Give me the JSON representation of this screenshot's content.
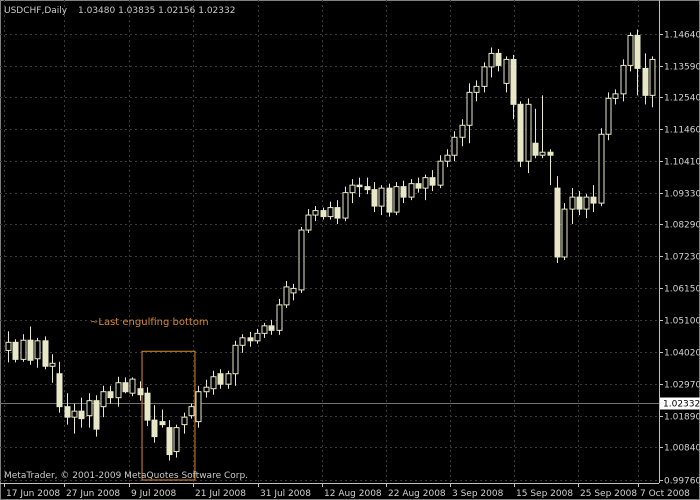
{
  "header": {
    "symbol_timeframe": "USDCHF,Daily",
    "ohlc": "1.03480 1.03835 1.02156 1.02332"
  },
  "footer": {
    "copyright": "MetaTrader, © 2001-2009 MetaQuotes Software Corp."
  },
  "annotation": {
    "text": "~Last engulfing bottom"
  },
  "current_price_label": "1.02332",
  "colors": {
    "background": "#000000",
    "grid": "#3a3a3a",
    "candle_bull": "#000000",
    "candle_bear": "#e8e8c8",
    "wick": "#e8e8c8",
    "annotation": "#d98c2a",
    "axis_text": "#d0d0d0"
  },
  "chart_data": {
    "type": "candlestick",
    "symbol": "USDCHF",
    "timeframe": "Daily",
    "x_ticks": [
      "17 Jun 2008",
      "27 Jun 2008",
      "9 Jul 2008",
      "21 Jul 2008",
      "31 Jul 2008",
      "12 Aug 2008",
      "22 Aug 2008",
      "3 Sep 2008",
      "15 Sep 2008",
      "25 Sep 2008",
      "7 Oct 2008"
    ],
    "y_ticks": [
      "1.14640",
      "1.13590",
      "1.12540",
      "1.11460",
      "1.10410",
      "1.09330",
      "1.08290",
      "1.07230",
      "1.06150",
      "1.05100",
      "1.04020",
      "1.02970",
      "1.01890",
      "1.00840",
      "0.99760"
    ],
    "y_range": [
      0.9965,
      1.1505
    ],
    "current_price": 1.02332,
    "candles": [
      {
        "o": 1.0408,
        "h": 1.0472,
        "l": 1.0368,
        "c": 1.0435
      },
      {
        "o": 1.0435,
        "h": 1.0445,
        "l": 1.0368,
        "c": 1.0378
      },
      {
        "o": 1.0378,
        "h": 1.0462,
        "l": 1.037,
        "c": 1.0442
      },
      {
        "o": 1.0442,
        "h": 1.0488,
        "l": 1.036,
        "c": 1.0375
      },
      {
        "o": 1.038,
        "h": 1.045,
        "l": 1.035,
        "c": 1.044
      },
      {
        "o": 1.044,
        "h": 1.0455,
        "l": 1.0345,
        "c": 1.0355
      },
      {
        "o": 1.0355,
        "h": 1.0395,
        "l": 1.03,
        "c": 1.0365
      },
      {
        "o": 1.033,
        "h": 1.037,
        "l": 1.02,
        "c": 1.022
      },
      {
        "o": 1.022,
        "h": 1.0265,
        "l": 1.016,
        "c": 1.0185
      },
      {
        "o": 1.0185,
        "h": 1.023,
        "l": 1.013,
        "c": 1.0205
      },
      {
        "o": 1.0205,
        "h": 1.025,
        "l": 1.015,
        "c": 1.018
      },
      {
        "o": 1.019,
        "h": 1.0265,
        "l": 1.015,
        "c": 1.024
      },
      {
        "o": 1.024,
        "h": 1.0258,
        "l": 1.012,
        "c": 1.0145
      },
      {
        "o": 1.022,
        "h": 1.029,
        "l": 1.0185,
        "c": 1.027
      },
      {
        "o": 1.027,
        "h": 1.029,
        "l": 1.023,
        "c": 1.025
      },
      {
        "o": 1.025,
        "h": 1.032,
        "l": 1.022,
        "c": 1.03
      },
      {
        "o": 1.03,
        "h": 1.0318,
        "l": 1.0265,
        "c": 1.027
      },
      {
        "o": 1.0265,
        "h": 1.0318,
        "l": 1.0255,
        "c": 1.0312
      },
      {
        "o": 1.028,
        "h": 1.0305,
        "l": 1.024,
        "c": 1.026
      },
      {
        "o": 1.0265,
        "h": 1.0285,
        "l": 1.0155,
        "c": 1.0175
      },
      {
        "o": 1.0175,
        "h": 1.0225,
        "l": 1.01,
        "c": 1.012
      },
      {
        "o": 1.017,
        "h": 1.021,
        "l": 1.015,
        "c": 1.016
      },
      {
        "o": 1.015,
        "h": 1.0175,
        "l": 1.004,
        "c": 1.006
      },
      {
        "o": 1.007,
        "h": 1.016,
        "l": 1.005,
        "c": 1.015
      },
      {
        "o": 1.016,
        "h": 1.02,
        "l": 1.013,
        "c": 1.0185
      },
      {
        "o": 1.019,
        "h": 1.023,
        "l": 1.018,
        "c": 1.022
      },
      {
        "o": 1.017,
        "h": 1.029,
        "l": 1.015,
        "c": 1.027
      },
      {
        "o": 1.027,
        "h": 1.031,
        "l": 1.025,
        "c": 1.0285
      },
      {
        "o": 1.028,
        "h": 1.034,
        "l": 1.026,
        "c": 1.032
      },
      {
        "o": 1.033,
        "h": 1.0345,
        "l": 1.028,
        "c": 1.0295
      },
      {
        "o": 1.0295,
        "h": 1.034,
        "l": 1.028,
        "c": 1.033
      },
      {
        "o": 1.033,
        "h": 1.044,
        "l": 1.029,
        "c": 1.0425
      },
      {
        "o": 1.0425,
        "h": 1.0462,
        "l": 1.04,
        "c": 1.045
      },
      {
        "o": 1.045,
        "h": 1.047,
        "l": 1.042,
        "c": 1.044
      },
      {
        "o": 1.044,
        "h": 1.048,
        "l": 1.043,
        "c": 1.0465
      },
      {
        "o": 1.0465,
        "h": 1.05,
        "l": 1.045,
        "c": 1.049
      },
      {
        "o": 1.049,
        "h": 1.051,
        "l": 1.046,
        "c": 1.0475
      },
      {
        "o": 1.0475,
        "h": 1.058,
        "l": 1.046,
        "c": 1.056
      },
      {
        "o": 1.056,
        "h": 1.064,
        "l": 1.055,
        "c": 1.062
      },
      {
        "o": 1.06,
        "h": 1.063,
        "l": 1.0575,
        "c": 1.0615
      },
      {
        "o": 1.061,
        "h": 1.082,
        "l": 1.06,
        "c": 1.081
      },
      {
        "o": 1.081,
        "h": 1.088,
        "l": 1.08,
        "c": 1.086
      },
      {
        "o": 1.086,
        "h": 1.089,
        "l": 1.084,
        "c": 1.0875
      },
      {
        "o": 1.0875,
        "h": 1.0885,
        "l": 1.0845,
        "c": 1.0855
      },
      {
        "o": 1.0855,
        "h": 1.0905,
        "l": 1.0845,
        "c": 1.0885
      },
      {
        "o": 1.0885,
        "h": 1.091,
        "l": 1.083,
        "c": 1.085
      },
      {
        "o": 1.085,
        "h": 1.0955,
        "l": 1.084,
        "c": 1.0935
      },
      {
        "o": 1.0935,
        "h": 1.098,
        "l": 1.09,
        "c": 1.096
      },
      {
        "o": 1.096,
        "h": 1.0985,
        "l": 1.092,
        "c": 1.0955
      },
      {
        "o": 1.0955,
        "h": 1.0985,
        "l": 1.093,
        "c": 1.0945
      },
      {
        "o": 1.0945,
        "h": 1.097,
        "l": 1.087,
        "c": 1.089
      },
      {
        "o": 1.089,
        "h": 1.096,
        "l": 1.086,
        "c": 1.095
      },
      {
        "o": 1.095,
        "h": 1.0965,
        "l": 1.0855,
        "c": 1.087
      },
      {
        "o": 1.087,
        "h": 1.097,
        "l": 1.086,
        "c": 1.0955
      },
      {
        "o": 1.0955,
        "h": 1.0975,
        "l": 1.09,
        "c": 1.092
      },
      {
        "o": 1.092,
        "h": 1.098,
        "l": 1.091,
        "c": 1.0965
      },
      {
        "o": 1.0965,
        "h": 1.0985,
        "l": 1.0935,
        "c": 1.095
      },
      {
        "o": 1.095,
        "h": 1.0995,
        "l": 1.091,
        "c": 1.0985
      },
      {
        "o": 1.0985,
        "h": 1.101,
        "l": 1.094,
        "c": 1.096
      },
      {
        "o": 1.096,
        "h": 1.106,
        "l": 1.095,
        "c": 1.104
      },
      {
        "o": 1.104,
        "h": 1.108,
        "l": 1.102,
        "c": 1.106
      },
      {
        "o": 1.106,
        "h": 1.114,
        "l": 1.104,
        "c": 1.112
      },
      {
        "o": 1.112,
        "h": 1.118,
        "l": 1.109,
        "c": 1.116
      },
      {
        "o": 1.116,
        "h": 1.13,
        "l": 1.11,
        "c": 1.127
      },
      {
        "o": 1.127,
        "h": 1.131,
        "l": 1.124,
        "c": 1.129
      },
      {
        "o": 1.129,
        "h": 1.137,
        "l": 1.127,
        "c": 1.1355
      },
      {
        "o": 1.1355,
        "h": 1.142,
        "l": 1.132,
        "c": 1.14
      },
      {
        "o": 1.14,
        "h": 1.1415,
        "l": 1.134,
        "c": 1.136
      },
      {
        "o": 1.13,
        "h": 1.139,
        "l": 1.127,
        "c": 1.138
      },
      {
        "o": 1.138,
        "h": 1.1395,
        "l": 1.118,
        "c": 1.123
      },
      {
        "o": 1.123,
        "h": 1.124,
        "l": 1.102,
        "c": 1.104
      },
      {
        "o": 1.104,
        "h": 1.125,
        "l": 1.1,
        "c": 1.123
      },
      {
        "o": 1.11,
        "h": 1.1215,
        "l": 1.105,
        "c": 1.106
      },
      {
        "o": 1.106,
        "h": 1.126,
        "l": 1.105,
        "c": 1.107
      },
      {
        "o": 1.107,
        "h": 1.108,
        "l": 1.096,
        "c": 1.106
      },
      {
        "o": 1.095,
        "h": 1.099,
        "l": 1.07,
        "c": 1.072
      },
      {
        "o": 1.072,
        "h": 1.09,
        "l": 1.071,
        "c": 1.088
      },
      {
        "o": 1.088,
        "h": 1.095,
        "l": 1.083,
        "c": 1.092
      },
      {
        "o": 1.092,
        "h": 1.094,
        "l": 1.086,
        "c": 1.088
      },
      {
        "o": 1.088,
        "h": 1.093,
        "l": 1.085,
        "c": 1.092
      },
      {
        "o": 1.092,
        "h": 1.096,
        "l": 1.087,
        "c": 1.09
      },
      {
        "o": 1.09,
        "h": 1.115,
        "l": 1.089,
        "c": 1.113
      },
      {
        "o": 1.113,
        "h": 1.127,
        "l": 1.111,
        "c": 1.125
      },
      {
        "o": 1.125,
        "h": 1.128,
        "l": 1.123,
        "c": 1.1265
      },
      {
        "o": 1.1265,
        "h": 1.138,
        "l": 1.124,
        "c": 1.136
      },
      {
        "o": 1.136,
        "h": 1.147,
        "l": 1.134,
        "c": 1.146
      },
      {
        "o": 1.146,
        "h": 1.148,
        "l": 1.126,
        "c": 1.135
      },
      {
        "o": 1.135,
        "h": 1.14,
        "l": 1.123,
        "c": 1.126
      },
      {
        "o": 1.126,
        "h": 1.139,
        "l": 1.122,
        "c": 1.138
      }
    ],
    "annotation_box": {
      "from_candle": 19,
      "to_candle": 25,
      "price_high": 1.0405,
      "price_low": 0.9975
    }
  }
}
